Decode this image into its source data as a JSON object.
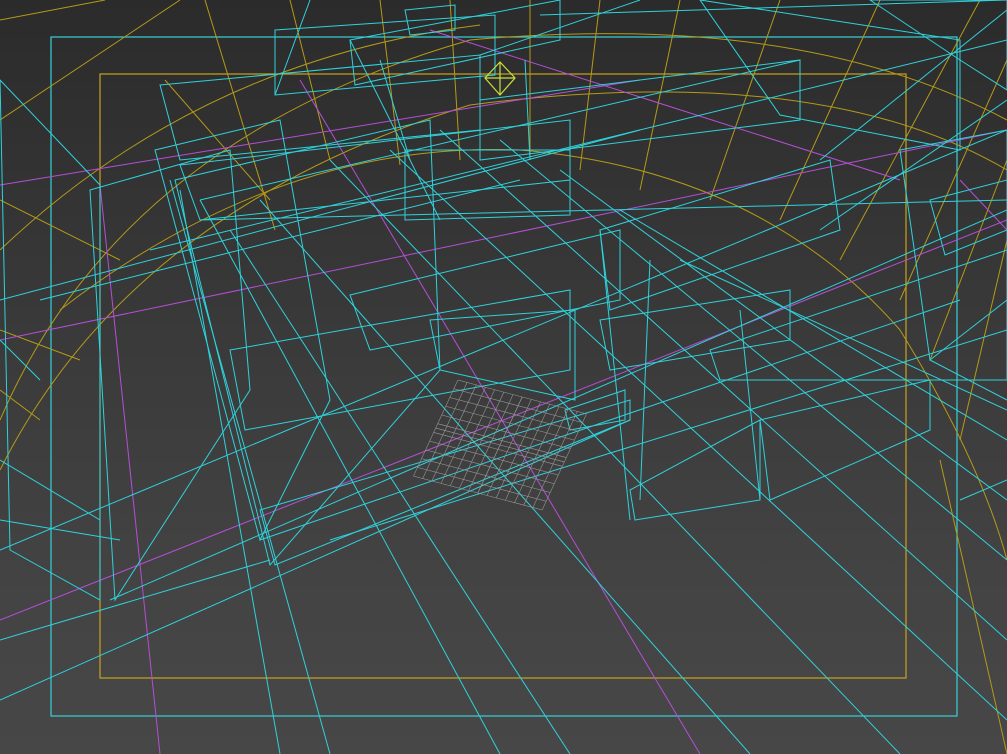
{
  "viewport": {
    "background_top": "#2b2b2b",
    "background_bottom": "#474747",
    "colors": {
      "wire_cyan": "#2fd2dc",
      "wire_yellow": "#b59a18",
      "wire_magenta": "#b54fd6",
      "grid": "#9a9a9a",
      "gizmo": "#c8e03a"
    }
  }
}
